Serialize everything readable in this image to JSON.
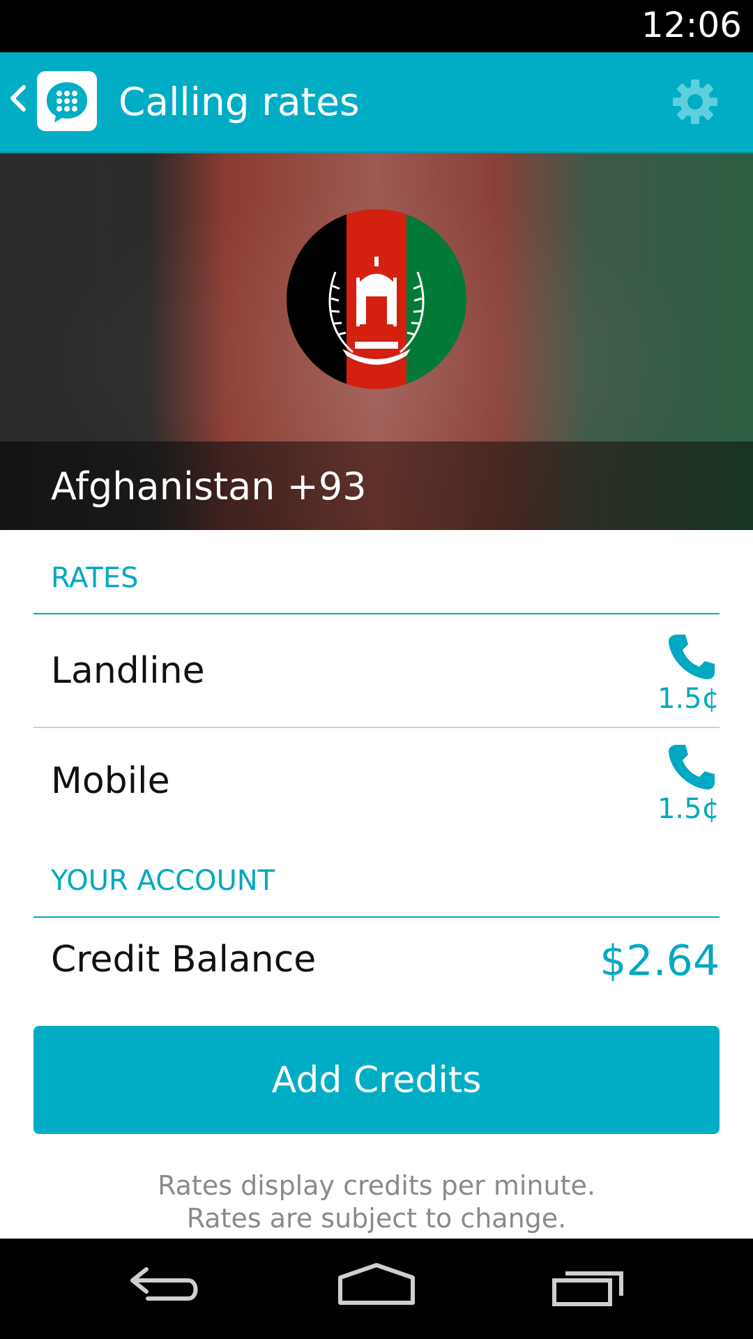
{
  "status_bar": {
    "time": "12:06"
  },
  "action_bar": {
    "title": "Calling rates",
    "back_icon": "chevron-left-icon",
    "app_icon": "dialpad-bubble-icon",
    "settings_icon": "gear-icon"
  },
  "hero": {
    "flag": "afghanistan-flag",
    "country": "Afghanistan +93"
  },
  "rates_section": {
    "header": "RATES",
    "rows": [
      {
        "label": "Landline",
        "icon": "phone-icon",
        "rate": "1.5¢"
      },
      {
        "label": "Mobile",
        "icon": "phone-icon",
        "rate": "1.5¢"
      }
    ]
  },
  "account_section": {
    "header": "YOUR ACCOUNT",
    "credit_label": "Credit Balance",
    "credit_value": "$2.64"
  },
  "add_credits_label": "Add Credits",
  "footnote": {
    "line1": "Rates display credits per minute.",
    "line2": "Rates are subject to change."
  },
  "nav_bar": {
    "back_icon": "nav-back-icon",
    "home_icon": "nav-home-icon",
    "recents_icon": "nav-recents-icon"
  },
  "colors": {
    "accent": "#00adc5",
    "accent_text": "#00a8c1",
    "flag_black": "#000000",
    "flag_red": "#d32011",
    "flag_green": "#007a36"
  }
}
